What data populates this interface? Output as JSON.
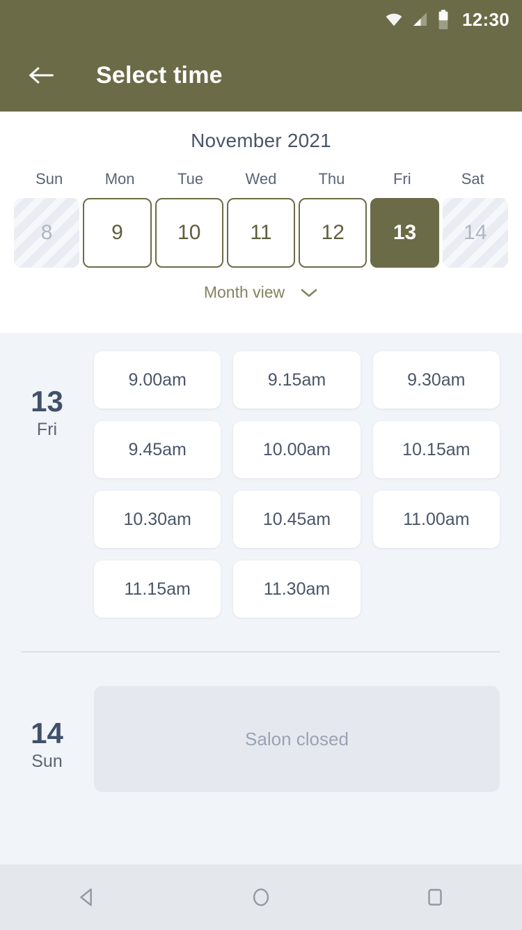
{
  "status_bar": {
    "time": "12:30",
    "icons": [
      "wifi-icon",
      "signal-icon",
      "battery-icon"
    ]
  },
  "app_bar": {
    "back_icon": "arrow-left-icon",
    "title": "Select time"
  },
  "calendar": {
    "month_title": "November 2021",
    "weekdays": [
      "Sun",
      "Mon",
      "Tue",
      "Wed",
      "Thu",
      "Fri",
      "Sat"
    ],
    "days": [
      {
        "number": "8",
        "state": "disabled"
      },
      {
        "number": "9",
        "state": "available"
      },
      {
        "number": "10",
        "state": "available"
      },
      {
        "number": "11",
        "state": "available"
      },
      {
        "number": "12",
        "state": "available"
      },
      {
        "number": "13",
        "state": "selected"
      },
      {
        "number": "14",
        "state": "disabled"
      }
    ],
    "month_view_label": "Month view",
    "month_view_icon": "chevron-down-icon"
  },
  "slots": {
    "groups": [
      {
        "day_number": "13",
        "day_of_week": "Fri",
        "times": [
          "9.00am",
          "9.15am",
          "9.30am",
          "9.45am",
          "10.00am",
          "10.15am",
          "10.30am",
          "10.45am",
          "11.00am",
          "11.15am",
          "11.30am"
        ]
      },
      {
        "day_number": "14",
        "day_of_week": "Sun",
        "closed_label": "Salon closed"
      }
    ]
  },
  "nav_bar": {
    "back_icon": "triangle-back-icon",
    "home_icon": "circle-home-icon",
    "recents_icon": "square-recents-icon"
  },
  "colors": {
    "brand_olive": "#6B6B48",
    "slate": "#4A5568",
    "panel_bg": "#F1F4F8",
    "nav_bg": "#E4E7EC"
  }
}
